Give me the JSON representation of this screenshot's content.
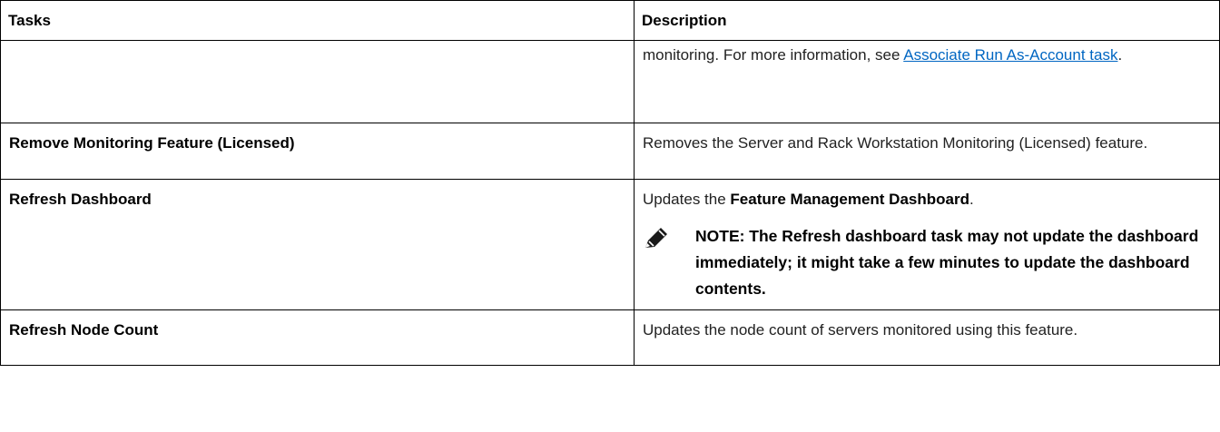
{
  "table": {
    "headers": {
      "tasks": "Tasks",
      "description": "Description"
    },
    "rows": [
      {
        "task": "",
        "description": {
          "before_link": "monitoring. For more information, see ",
          "link": "Associate Run As-Account task",
          "after_link": "."
        }
      },
      {
        "task": "Remove Monitoring Feature (Licensed)",
        "description": {
          "text": "Removes the Server and Rack Workstation Monitoring (Licensed) feature."
        }
      },
      {
        "task": "Refresh Dashboard",
        "description": {
          "before_strong": "Updates the ",
          "strong": "Feature Management Dashboard",
          "after_strong": ".",
          "note": "NOTE: The Refresh dashboard task may not update the dashboard immediately; it might take a few minutes to update the dashboard contents.",
          "note_icon": "pencil-note-icon"
        }
      },
      {
        "task": "Refresh Node Count",
        "description": {
          "text": "Updates the node count of servers monitored using this feature."
        }
      }
    ]
  },
  "colors": {
    "link": "#0066c2",
    "border": "#000000",
    "text": "#222222"
  }
}
